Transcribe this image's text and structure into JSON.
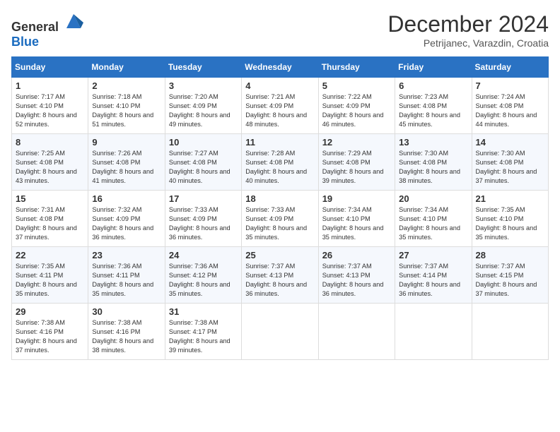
{
  "header": {
    "logo_general": "General",
    "logo_blue": "Blue",
    "month_title": "December 2024",
    "location": "Petrijanec, Varazdin, Croatia"
  },
  "days_of_week": [
    "Sunday",
    "Monday",
    "Tuesday",
    "Wednesday",
    "Thursday",
    "Friday",
    "Saturday"
  ],
  "weeks": [
    [
      {
        "day": "1",
        "sunrise": "7:17 AM",
        "sunset": "4:10 PM",
        "daylight": "8 hours and 52 minutes."
      },
      {
        "day": "2",
        "sunrise": "7:18 AM",
        "sunset": "4:10 PM",
        "daylight": "8 hours and 51 minutes."
      },
      {
        "day": "3",
        "sunrise": "7:20 AM",
        "sunset": "4:09 PM",
        "daylight": "8 hours and 49 minutes."
      },
      {
        "day": "4",
        "sunrise": "7:21 AM",
        "sunset": "4:09 PM",
        "daylight": "8 hours and 48 minutes."
      },
      {
        "day": "5",
        "sunrise": "7:22 AM",
        "sunset": "4:09 PM",
        "daylight": "8 hours and 46 minutes."
      },
      {
        "day": "6",
        "sunrise": "7:23 AM",
        "sunset": "4:08 PM",
        "daylight": "8 hours and 45 minutes."
      },
      {
        "day": "7",
        "sunrise": "7:24 AM",
        "sunset": "4:08 PM",
        "daylight": "8 hours and 44 minutes."
      }
    ],
    [
      {
        "day": "8",
        "sunrise": "7:25 AM",
        "sunset": "4:08 PM",
        "daylight": "8 hours and 43 minutes."
      },
      {
        "day": "9",
        "sunrise": "7:26 AM",
        "sunset": "4:08 PM",
        "daylight": "8 hours and 41 minutes."
      },
      {
        "day": "10",
        "sunrise": "7:27 AM",
        "sunset": "4:08 PM",
        "daylight": "8 hours and 40 minutes."
      },
      {
        "day": "11",
        "sunrise": "7:28 AM",
        "sunset": "4:08 PM",
        "daylight": "8 hours and 40 minutes."
      },
      {
        "day": "12",
        "sunrise": "7:29 AM",
        "sunset": "4:08 PM",
        "daylight": "8 hours and 39 minutes."
      },
      {
        "day": "13",
        "sunrise": "7:30 AM",
        "sunset": "4:08 PM",
        "daylight": "8 hours and 38 minutes."
      },
      {
        "day": "14",
        "sunrise": "7:30 AM",
        "sunset": "4:08 PM",
        "daylight": "8 hours and 37 minutes."
      }
    ],
    [
      {
        "day": "15",
        "sunrise": "7:31 AM",
        "sunset": "4:08 PM",
        "daylight": "8 hours and 37 minutes."
      },
      {
        "day": "16",
        "sunrise": "7:32 AM",
        "sunset": "4:09 PM",
        "daylight": "8 hours and 36 minutes."
      },
      {
        "day": "17",
        "sunrise": "7:33 AM",
        "sunset": "4:09 PM",
        "daylight": "8 hours and 36 minutes."
      },
      {
        "day": "18",
        "sunrise": "7:33 AM",
        "sunset": "4:09 PM",
        "daylight": "8 hours and 35 minutes."
      },
      {
        "day": "19",
        "sunrise": "7:34 AM",
        "sunset": "4:10 PM",
        "daylight": "8 hours and 35 minutes."
      },
      {
        "day": "20",
        "sunrise": "7:34 AM",
        "sunset": "4:10 PM",
        "daylight": "8 hours and 35 minutes."
      },
      {
        "day": "21",
        "sunrise": "7:35 AM",
        "sunset": "4:10 PM",
        "daylight": "8 hours and 35 minutes."
      }
    ],
    [
      {
        "day": "22",
        "sunrise": "7:35 AM",
        "sunset": "4:11 PM",
        "daylight": "8 hours and 35 minutes."
      },
      {
        "day": "23",
        "sunrise": "7:36 AM",
        "sunset": "4:11 PM",
        "daylight": "8 hours and 35 minutes."
      },
      {
        "day": "24",
        "sunrise": "7:36 AM",
        "sunset": "4:12 PM",
        "daylight": "8 hours and 35 minutes."
      },
      {
        "day": "25",
        "sunrise": "7:37 AM",
        "sunset": "4:13 PM",
        "daylight": "8 hours and 36 minutes."
      },
      {
        "day": "26",
        "sunrise": "7:37 AM",
        "sunset": "4:13 PM",
        "daylight": "8 hours and 36 minutes."
      },
      {
        "day": "27",
        "sunrise": "7:37 AM",
        "sunset": "4:14 PM",
        "daylight": "8 hours and 36 minutes."
      },
      {
        "day": "28",
        "sunrise": "7:37 AM",
        "sunset": "4:15 PM",
        "daylight": "8 hours and 37 minutes."
      }
    ],
    [
      {
        "day": "29",
        "sunrise": "7:38 AM",
        "sunset": "4:16 PM",
        "daylight": "8 hours and 37 minutes."
      },
      {
        "day": "30",
        "sunrise": "7:38 AM",
        "sunset": "4:16 PM",
        "daylight": "8 hours and 38 minutes."
      },
      {
        "day": "31",
        "sunrise": "7:38 AM",
        "sunset": "4:17 PM",
        "daylight": "8 hours and 39 minutes."
      },
      null,
      null,
      null,
      null
    ]
  ],
  "labels": {
    "sunrise": "Sunrise:",
    "sunset": "Sunset:",
    "daylight": "Daylight:"
  }
}
